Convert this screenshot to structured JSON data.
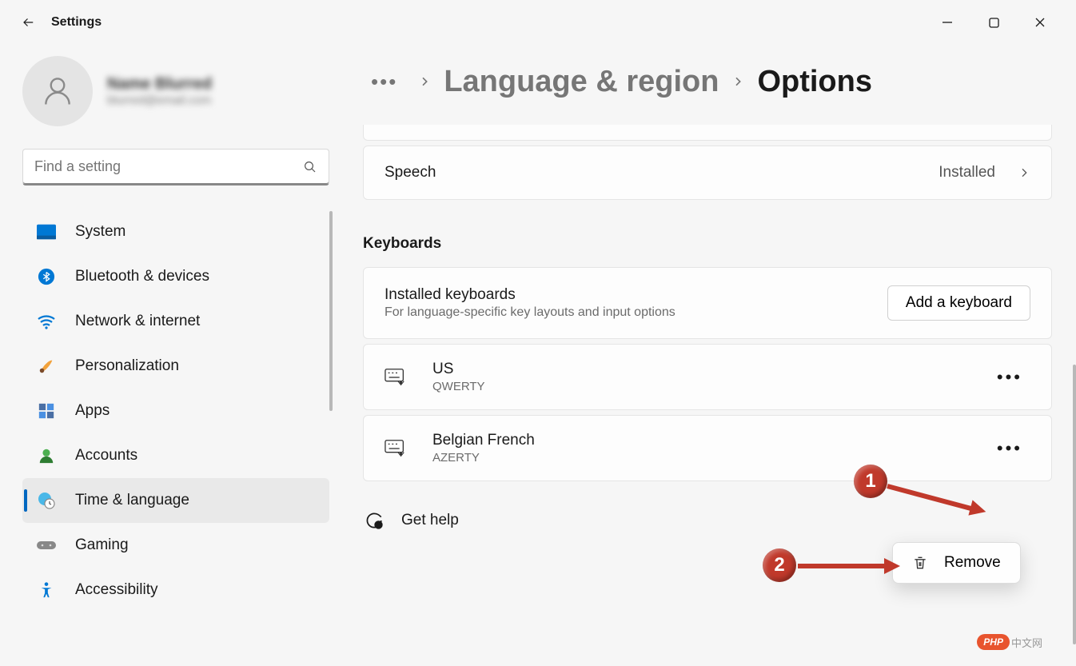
{
  "app_title": "Settings",
  "profile": {
    "name": "Name Blurred",
    "email": "blurred@email.com"
  },
  "search": {
    "placeholder": "Find a setting"
  },
  "nav": [
    {
      "label": "System",
      "icon": "system"
    },
    {
      "label": "Bluetooth & devices",
      "icon": "bluetooth"
    },
    {
      "label": "Network & internet",
      "icon": "network"
    },
    {
      "label": "Personalization",
      "icon": "personalization"
    },
    {
      "label": "Apps",
      "icon": "apps"
    },
    {
      "label": "Accounts",
      "icon": "accounts"
    },
    {
      "label": "Time & language",
      "icon": "time-language",
      "active": true
    },
    {
      "label": "Gaming",
      "icon": "gaming"
    },
    {
      "label": "Accessibility",
      "icon": "accessibility"
    }
  ],
  "breadcrumb": {
    "parent": "Language & region",
    "current": "Options"
  },
  "speech": {
    "label": "Speech",
    "status": "Installed"
  },
  "keyboards_section": {
    "title": "Keyboards",
    "installed_title": "Installed keyboards",
    "installed_sub": "For language-specific key layouts and input options",
    "add_btn": "Add a keyboard"
  },
  "keyboards": [
    {
      "name": "US",
      "layout": "QWERTY"
    },
    {
      "name": "Belgian French",
      "layout": "AZERTY"
    }
  ],
  "remove_label": "Remove",
  "help_label": "Get help",
  "annotations": {
    "b1": "1",
    "b2": "2"
  },
  "watermark": {
    "badge": "PHP",
    "text": "中文网"
  }
}
